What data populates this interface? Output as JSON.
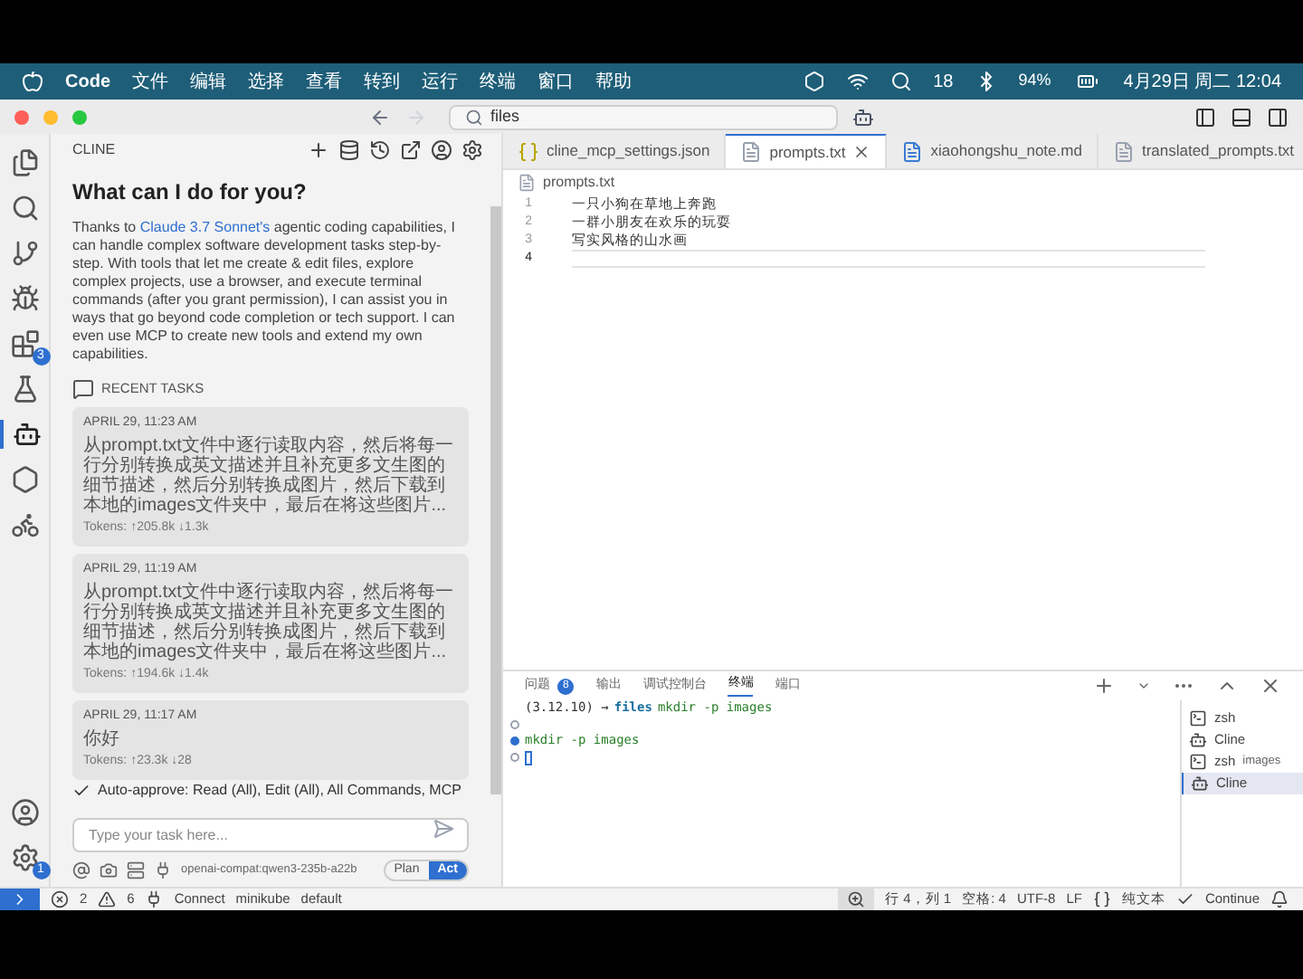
{
  "menubar": {
    "app": "Code",
    "menus": [
      "文件",
      "编辑",
      "选择",
      "查看",
      "转到",
      "运行",
      "终端",
      "窗口",
      "帮助"
    ],
    "vpn_count": "18",
    "battery": "94%",
    "clock": "4月29日 周二 12:04"
  },
  "titlebar": {
    "search": "files"
  },
  "activity": {
    "extensions_badge": "3",
    "settings_badge": "1"
  },
  "sidebar": {
    "title": "CLINE",
    "heading": "What can I do for you?",
    "intro_before": "Thanks to ",
    "intro_link": "Claude 3.7 Sonnet's",
    "intro_after": " agentic coding capabilities, I can handle complex software development tasks step-by-step. With tools that let me create & edit files, explore complex projects, use a browser, and execute terminal commands (after you grant permission), I can assist you in ways that go beyond code completion or tech support. I can even use MCP to create new tools and extend my own capabilities.",
    "recent_title": "RECENT TASKS",
    "tasks": [
      {
        "date": "APRIL 29, 11:23 AM",
        "text": "从prompt.txt文件中逐行读取内容，然后将每一行分别转换成英文描述并且补充更多文生图的细节描述，然后分别转换成图片，然后下载到本地的images文件夹中，最后在将这些图片...",
        "tokens": "Tokens: ↑205.8k ↓1.3k"
      },
      {
        "date": "APRIL 29, 11:19 AM",
        "text": "从prompt.txt文件中逐行读取内容，然后将每一行分别转换成英文描述并且补充更多文生图的细节描述，然后分别转换成图片，然后下载到本地的images文件夹中，最后在将这些图片...",
        "tokens": "Tokens: ↑194.6k ↓1.4k"
      },
      {
        "date": "APRIL 29, 11:17 AM",
        "text": "你好",
        "tokens": "Tokens: ↑23.3k ↓28"
      }
    ],
    "auto_approve": {
      "checked": true,
      "text": "Auto-approve: Read (All), Edit (All), All Commands, MCP"
    },
    "input": {
      "placeholder": "Type your task here..."
    },
    "model": "openai-compat:qwen3-235b-a22b",
    "modes": [
      {
        "label": "Plan",
        "selected": false
      },
      {
        "label": "Act",
        "selected": true
      }
    ]
  },
  "tabs": [
    {
      "label": "cline_mcp_settings.json",
      "kind": "json",
      "selected": false
    },
    {
      "label": "prompts.txt",
      "kind": "txt",
      "selected": true
    },
    {
      "label": "xiaohongshu_note.md",
      "kind": "md",
      "selected": false
    },
    {
      "label": "translated_prompts.txt",
      "kind": "txt",
      "selected": false
    }
  ],
  "editor": {
    "breadcrumb": "prompts.txt",
    "lines": [
      {
        "number": "1",
        "text": "一只小狗在草地上奔跑",
        "current": false
      },
      {
        "number": "2",
        "text": "一群小朋友在欢乐的玩耍",
        "current": false
      },
      {
        "number": "3",
        "text": "写实风格的山水画",
        "current": false
      },
      {
        "number": "4",
        "current": true
      }
    ]
  },
  "panel": {
    "tabs": [
      {
        "label": "问题",
        "badge": "8",
        "selected": false
      },
      {
        "label": "输出",
        "selected": false
      },
      {
        "label": "调试控制台",
        "selected": false
      },
      {
        "label": "终端",
        "selected": true
      },
      {
        "label": "端口",
        "selected": false
      }
    ],
    "terminal": [
      {
        "kind": "prompt",
        "prompt": "(3.12.10) →",
        "dir": "files",
        "command": "mkdir -p images"
      },
      {
        "kind": "mark"
      },
      {
        "kind": "command",
        "command": "mkdir -p images"
      },
      {
        "kind": "mark",
        "cursor": true
      }
    ],
    "terminals": [
      {
        "label": "zsh",
        "kind": "shell",
        "selected": false
      },
      {
        "label": "Cline",
        "kind": "bot",
        "selected": false
      },
      {
        "label": "zsh",
        "detail": "images",
        "kind": "shell",
        "selected": false
      },
      {
        "label": "Cline",
        "kind": "bot",
        "selected": true
      }
    ]
  },
  "status": {
    "errors": "2",
    "warnings": "6",
    "connect": "Connect",
    "cluster": "minikube",
    "namespace": "default",
    "position": "行 4，列 1",
    "spaces": "空格: 4",
    "encoding": "UTF-8",
    "eol": "LF",
    "language": "纯文本",
    "continue": "Continue"
  }
}
